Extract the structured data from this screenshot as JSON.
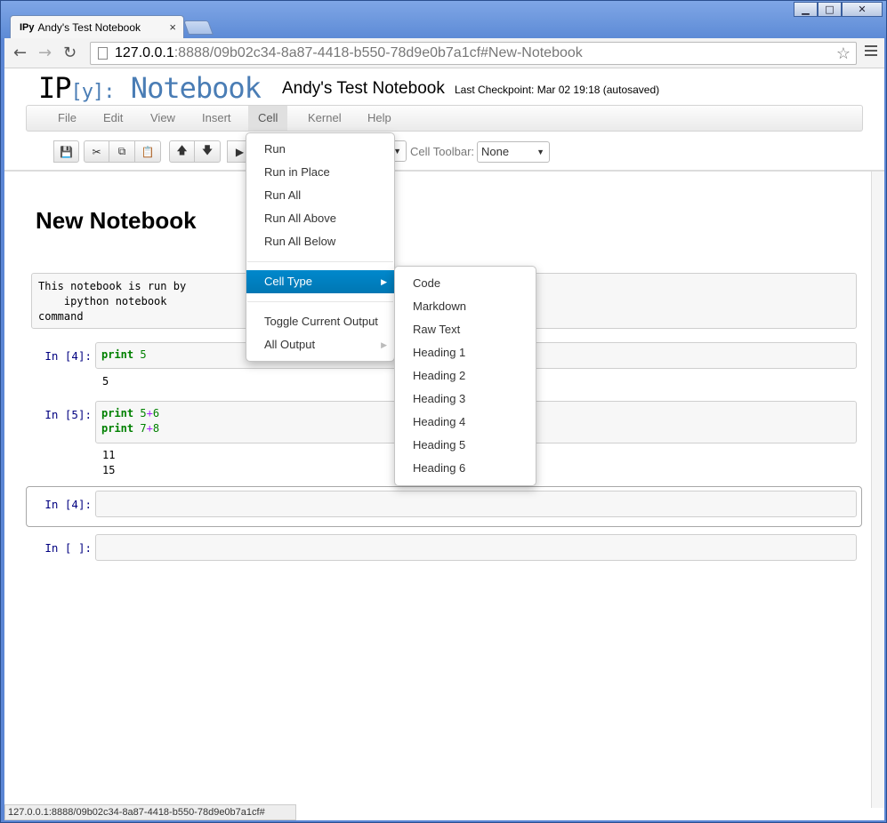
{
  "browser": {
    "tab_favicon": "IPy",
    "tab_title": "Andy's Test Notebook",
    "tab_close": "×",
    "url_host": "127.0.0.1",
    "url_rest": ":8888/09b02c34-8a87-4418-b550-78d9e0b7a1cf#New-Notebook",
    "status_url": "127.0.0.1:8888/09b02c34-8a87-4418-b550-78d9e0b7a1cf#"
  },
  "window_buttons": {
    "minimize": "▁",
    "maximize": "□",
    "close": "✕"
  },
  "nav": {
    "back": "←",
    "forward": "→",
    "reload": "↻",
    "star": "☆"
  },
  "header": {
    "logo_ip": "IP",
    "logo_bracket": "[y]",
    "logo_colon": ":",
    "logo_notebook": "Notebook",
    "notebook_name": "Andy's Test Notebook",
    "checkpoint": "Last Checkpoint: Mar 02 19:18 (autosaved)"
  },
  "menubar": {
    "items": [
      "File",
      "Edit",
      "View",
      "Insert",
      "Cell",
      "Kernel",
      "Help"
    ],
    "active": "Cell"
  },
  "toolbar": {
    "icons": {
      "save": "💾",
      "cut": "✂",
      "copy": "⧉",
      "paste": "📋",
      "up": "🡅",
      "down": "🡇",
      "run": "▶"
    },
    "cell_toolbar_label": "Cell Toolbar:",
    "cell_toolbar_value": "None",
    "select_arrow": "▼"
  },
  "notebook": {
    "heading": "New Notebook",
    "raw_text": "This notebook is run by\n    ipython notebook\ncommand",
    "cells": [
      {
        "prompt": "In [4]:",
        "output": "5"
      },
      {
        "prompt": "In [5]:",
        "output": [
          "11",
          "15"
        ]
      },
      {
        "prompt": "In [4]:"
      },
      {
        "prompt": "In [ ]:"
      }
    ],
    "code": {
      "c1_kw": "print",
      "c1_num": "5",
      "c2_kw1": "print",
      "c2_a": "5",
      "c2_op1": "+",
      "c2_b": "6",
      "c2_kw2": "print",
      "c2_c": "7",
      "c2_op2": "+",
      "c2_d": "8"
    }
  },
  "cell_menu": {
    "items": [
      "Run",
      "Run in Place",
      "Run All",
      "Run All Above",
      "Run All Below"
    ],
    "cell_type": "Cell Type",
    "toggle": "Toggle Current Output",
    "all_output": "All Output",
    "submenu_arrow": "▶"
  },
  "cell_type_menu": {
    "items": [
      "Code",
      "Markdown",
      "Raw Text",
      "Heading 1",
      "Heading 2",
      "Heading 3",
      "Heading 4",
      "Heading 5",
      "Heading 6"
    ]
  }
}
